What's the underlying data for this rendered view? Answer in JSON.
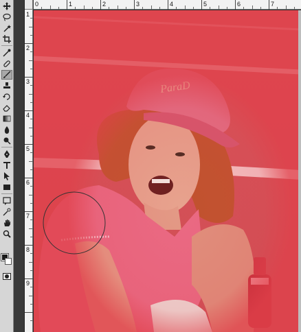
{
  "rulers": {
    "top": [
      "0",
      "1",
      "2",
      "3",
      "4",
      "5",
      "6",
      "7"
    ],
    "left": [
      "1",
      "2",
      "3",
      "4",
      "5",
      "6",
      "7",
      "8",
      "9"
    ]
  },
  "toolbox": {
    "tools": [
      "move-tool-icon",
      "lasso-tool-icon",
      "magic-wand-tool-icon",
      "crop-tool-icon",
      "eyedropper-tool-icon",
      "healing-brush-tool-icon",
      "brush-tool-icon",
      "clone-stamp-tool-icon",
      "history-brush-tool-icon",
      "eraser-tool-icon",
      "gradient-tool-icon",
      "blur-tool-icon",
      "dodge-tool-icon",
      "pen-tool-icon",
      "type-tool-icon",
      "path-selection-tool-icon",
      "shape-tool-icon",
      "notes-tool-icon",
      "hand-tool-icon",
      "zoom-tool-icon"
    ],
    "active_tool": "brush-tool-icon",
    "foreground_color": "#1a1a1a",
    "background_color": "#ffffff"
  },
  "canvas": {
    "quick_mask_overlay_color": "#e0404a",
    "brush_cursor": "circle"
  }
}
